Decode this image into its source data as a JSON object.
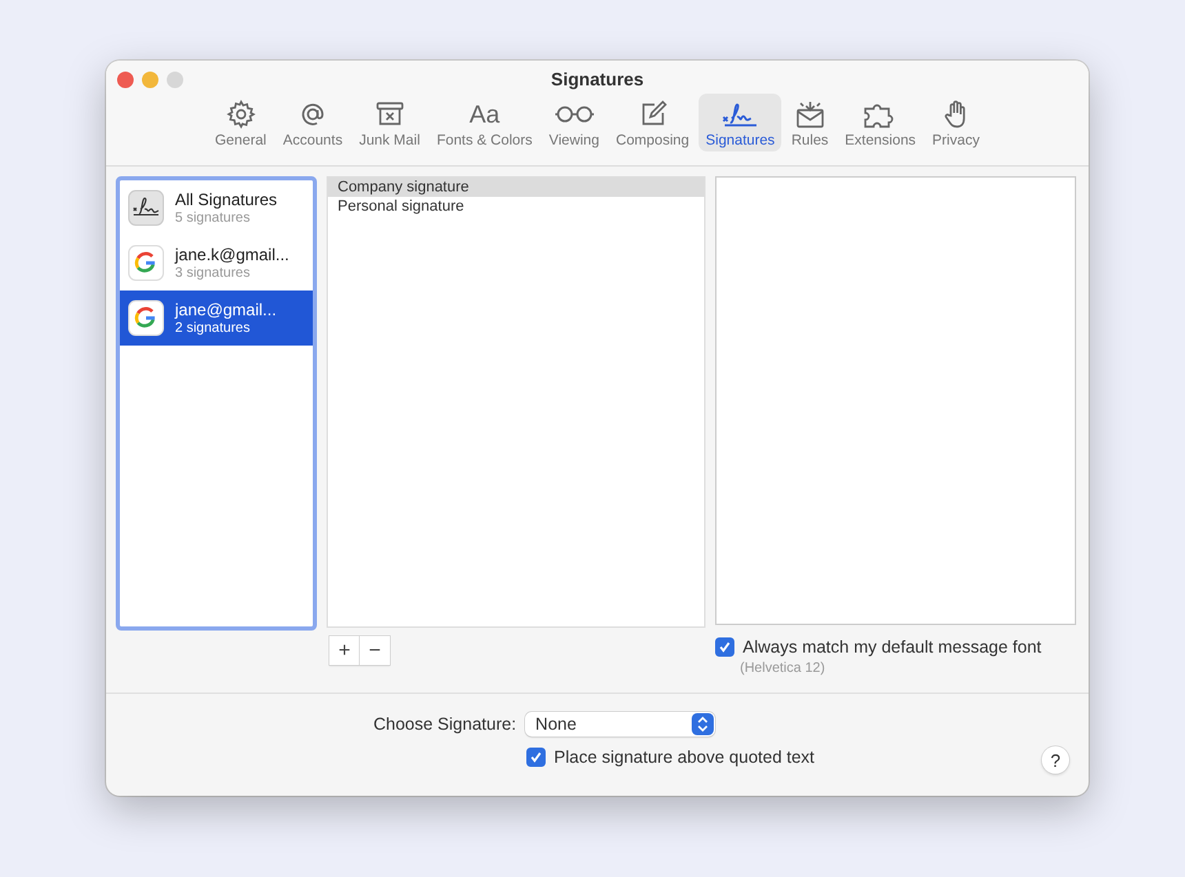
{
  "window": {
    "title": "Signatures"
  },
  "tabs": [
    {
      "label": "General",
      "kind": "gear",
      "selected": false
    },
    {
      "label": "Accounts",
      "kind": "at",
      "selected": false
    },
    {
      "label": "Junk Mail",
      "kind": "junk",
      "selected": false
    },
    {
      "label": "Fonts & Colors",
      "kind": "fonts",
      "glyph": "Aa",
      "selected": false
    },
    {
      "label": "Viewing",
      "kind": "glasses",
      "selected": false
    },
    {
      "label": "Composing",
      "kind": "compose",
      "selected": false
    },
    {
      "label": "Signatures",
      "kind": "signature",
      "selected": true
    },
    {
      "label": "Rules",
      "kind": "rules",
      "selected": false
    },
    {
      "label": "Extensions",
      "kind": "puzzle",
      "selected": false
    },
    {
      "label": "Privacy",
      "kind": "hand",
      "selected": false
    }
  ],
  "accounts": [
    {
      "kind": "all",
      "name": "All Signatures",
      "count": "5 signatures",
      "selected": false
    },
    {
      "kind": "google",
      "name": "jane.k@gmail...",
      "count": "3 signatures",
      "selected": false
    },
    {
      "kind": "google",
      "name": "jane@gmail...",
      "count": "2 signatures",
      "selected": true
    }
  ],
  "signatures": [
    {
      "name": "Company signature",
      "selected": true
    },
    {
      "name": "Personal signature",
      "selected": false
    }
  ],
  "list_buttons": [
    "+",
    "−"
  ],
  "match_font": {
    "label": "Always match my default message font",
    "checked": true,
    "note": "(Helvetica 12)"
  },
  "choose_signature": {
    "label": "Choose Signature:",
    "value": "None"
  },
  "place_above": {
    "label": "Place signature above quoted text",
    "checked": true
  },
  "help": "?"
}
